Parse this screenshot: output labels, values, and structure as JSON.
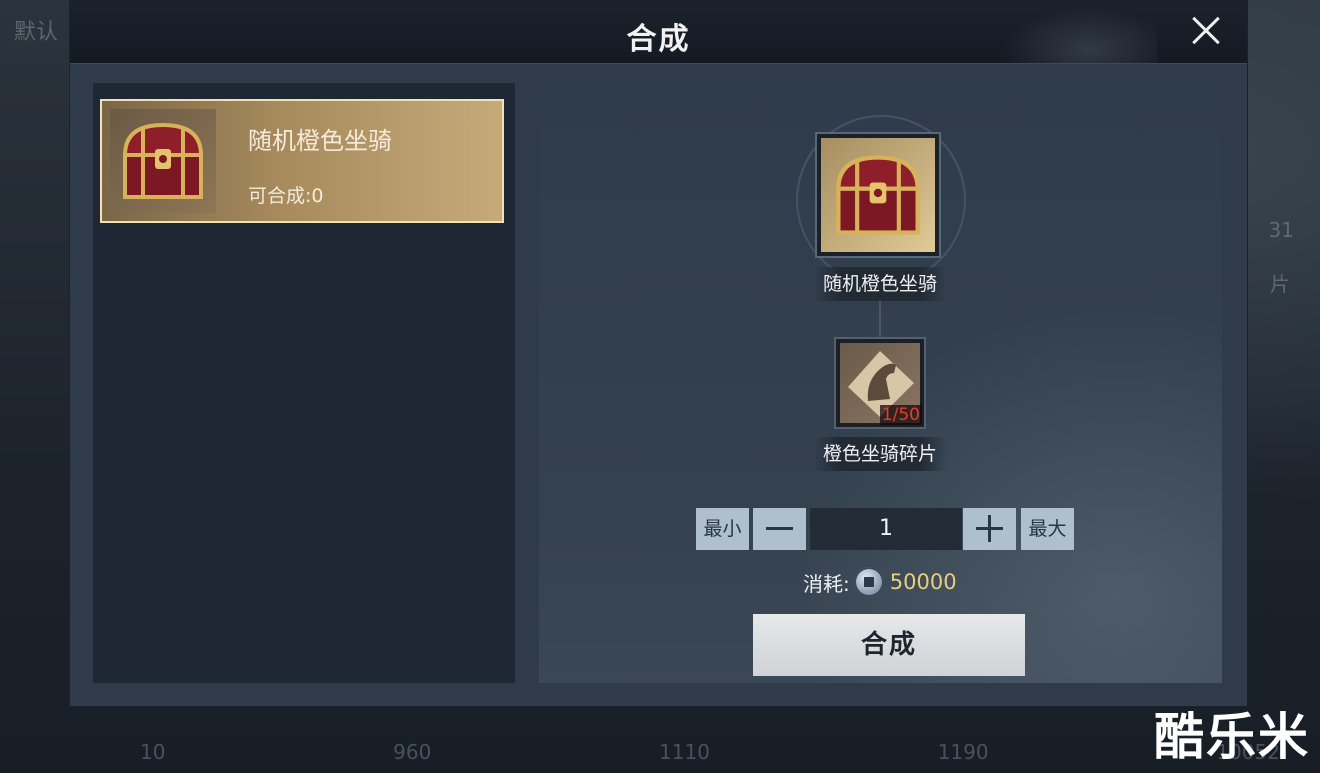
{
  "background": {
    "top_left_text": "默认",
    "right_number": "31",
    "right_char": "片",
    "bottom_numbers": [
      "10",
      "960",
      "1110",
      "1190",
      "10052"
    ]
  },
  "dialog": {
    "title": "合成"
  },
  "list": {
    "items": [
      {
        "name": "随机橙色坐骑",
        "count_label": "可合成:0",
        "icon": "treasure-chest-icon"
      }
    ]
  },
  "synthesis": {
    "target": {
      "name": "随机橙色坐骑",
      "icon": "treasure-chest-icon"
    },
    "material": {
      "name": "橙色坐骑碎片",
      "count": "1/50",
      "icon": "horse-fragment-icon"
    },
    "quantity": {
      "min_label": "最小",
      "max_label": "最大",
      "value": "1"
    },
    "cost": {
      "label": "消耗:",
      "currency_icon": "coin-icon",
      "amount": "50000"
    },
    "craft_button_label": "合成"
  },
  "watermark": "酷乐米",
  "colors": {
    "cost_amount": "#e9cf7c",
    "material_count": "#e43b34",
    "selected_border": "#f1e2b5"
  }
}
